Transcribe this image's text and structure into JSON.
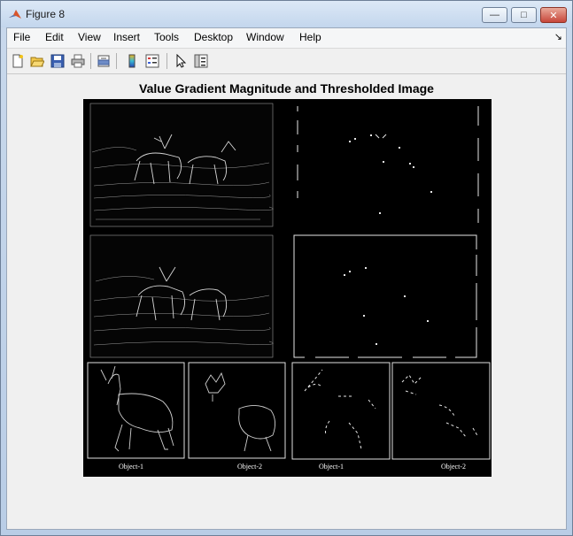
{
  "window": {
    "title": "Figure 8",
    "min_symbol": "—",
    "max_symbol": "□",
    "close_symbol": "✕"
  },
  "menubar": {
    "items": [
      "File",
      "Edit",
      "View",
      "Insert",
      "Tools",
      "Desktop",
      "Window",
      "Help"
    ],
    "arrow_symbol": "↘"
  },
  "toolbar": {
    "icons": [
      "new-figure-icon",
      "open-file-icon",
      "save-icon",
      "print-icon",
      "print-preview-icon",
      "colorbar-icon",
      "legend-icon",
      "pointer-icon",
      "property-editor-icon"
    ]
  },
  "plot": {
    "title": "Value Gradient Magnitude and Thresholded Image",
    "labels": [
      "Object-1",
      "Object-2",
      "Object-1",
      "Object-2"
    ]
  },
  "colors": {
    "titlebar": "#c3d6ed",
    "client_bg": "#f0f0f0",
    "figure_bg": "#000000",
    "close_button": "#c7463a"
  }
}
